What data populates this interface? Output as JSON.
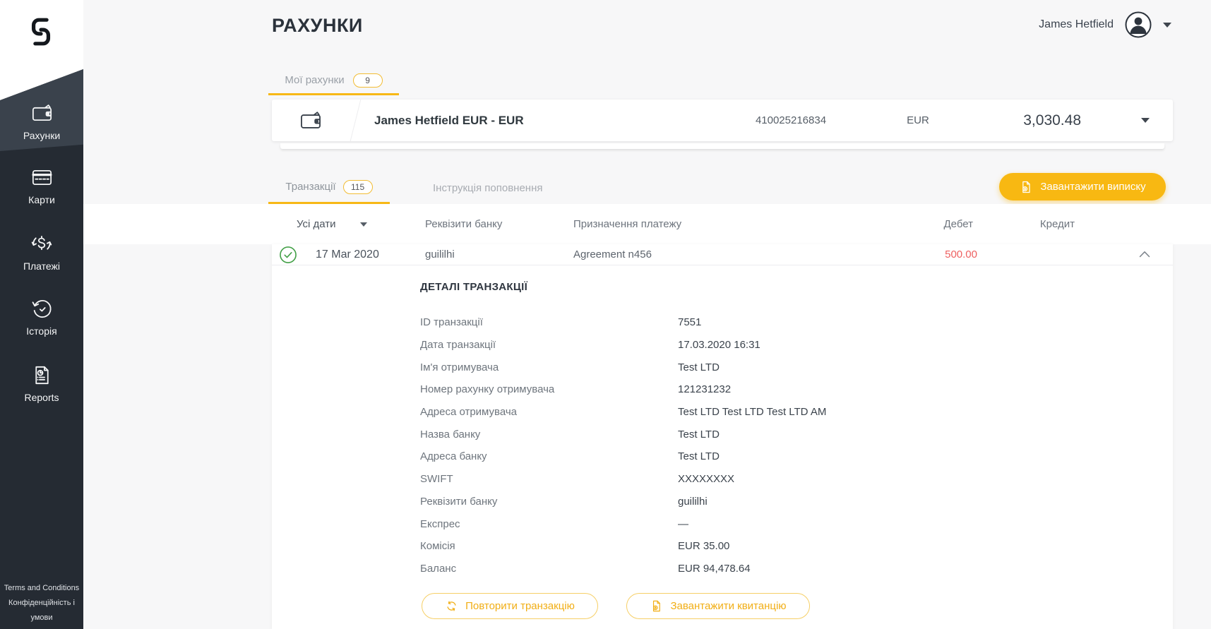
{
  "colors": {
    "accent_yellow": "#f8b812",
    "accent_border": "#f2bc33",
    "debit_red": "#ee6060",
    "success_green": "#43a047",
    "sidebar_bg": "#252b33",
    "sidebar_active_bg": "#3a424c"
  },
  "icons": {
    "logo": "brand-s-link",
    "wallet": "wallet",
    "card": "credit-card",
    "payments": "dollar-refresh",
    "history": "clock-arrow",
    "reports": "report-document",
    "download": "document-download",
    "repeat": "refresh-arrows",
    "check": "check-circle",
    "avatar": "person-circle",
    "chevron": "chevron-down"
  },
  "sidebar": {
    "items": [
      {
        "label": "Рахунки",
        "active": true
      },
      {
        "label": "Карти",
        "active": false
      },
      {
        "label": "Платежі",
        "active": false
      },
      {
        "label": "Історія",
        "active": false
      },
      {
        "label": "Reports",
        "active": false
      }
    ],
    "footer": [
      "Terms and Conditions",
      "Конфіденційність і умови"
    ]
  },
  "header": {
    "title": "РАХУНКИ",
    "user_name": "James Hetfield"
  },
  "accounts_tab": {
    "label": "Мої рахунки",
    "count": "9"
  },
  "account": {
    "name": "James Hetfield EUR - EUR",
    "number": "410025216834",
    "currency": "EUR",
    "balance": "3,030.48"
  },
  "tabs": {
    "transactions": {
      "label": "Транзакції",
      "count": "115"
    },
    "instruction": {
      "label": "Інструкція поповнення"
    }
  },
  "toolbar": {
    "download_statement": "Завантажити виписку"
  },
  "filter": {
    "all_dates": "Усі дати"
  },
  "columns": {
    "bank": "Реквізити банку",
    "purpose": "Призначення платежу",
    "debit": "Дебет",
    "credit": "Кредит"
  },
  "transaction": {
    "date": "17 Mar 2020",
    "bank": "guililhi",
    "purpose": "Agreement n456",
    "debit": "500.00"
  },
  "details": {
    "heading": "ДЕТАЛІ ТРАНЗАКЦІЇ",
    "rows": [
      {
        "label": "ID транзакції",
        "value": "7551"
      },
      {
        "label": "Дата транзакції",
        "value": "17.03.2020 16:31"
      },
      {
        "label": "Ім'я отримувача",
        "value": "Test LTD"
      },
      {
        "label": "Номер рахунку отримувача",
        "value": "121231232"
      },
      {
        "label": "Адреса отримувача",
        "value": "Test LTD Test LTD Test LTD AM"
      },
      {
        "label": "Назва банку",
        "value": "Test LTD"
      },
      {
        "label": "Адреса банку",
        "value": "Test LTD"
      },
      {
        "label": "SWIFT",
        "value": "XXXXXXXX"
      },
      {
        "label": "Реквізити банку",
        "value": "guililhi"
      },
      {
        "label": "Експрес",
        "value": "—"
      },
      {
        "label": "Комісія",
        "value": "EUR 35.00"
      },
      {
        "label": "Баланс",
        "value": "EUR 94,478.64"
      }
    ]
  },
  "actions": {
    "repeat": "Повторити транзакцію",
    "receipt": "Завантажити квитанцію"
  }
}
